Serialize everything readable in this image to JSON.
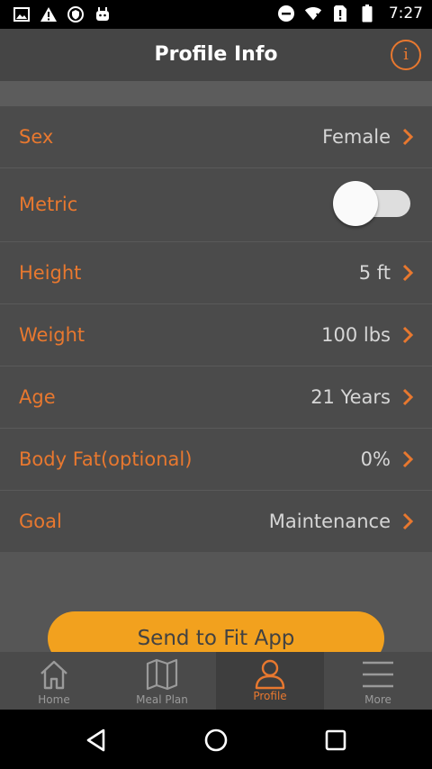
{
  "status_bar": {
    "time": "7:27",
    "icons_left": [
      "image-icon",
      "warning-icon",
      "shield-icon",
      "android-icon"
    ],
    "icons_right": [
      "minus-circle-icon",
      "wifi-icon",
      "no-sim-icon",
      "battery-icon"
    ]
  },
  "header": {
    "title": "Profile Info",
    "info_label": "i"
  },
  "rows": [
    {
      "label": "Sex",
      "value": "Female"
    },
    {
      "label": "Metric",
      "toggle_on": false
    },
    {
      "label": "Height",
      "value": "5 ft"
    },
    {
      "label": "Weight",
      "value": "100 lbs"
    },
    {
      "label": "Age",
      "value": "21 Years"
    },
    {
      "label": "Body Fat(optional)",
      "value": "0%"
    },
    {
      "label": "Goal",
      "value": "Maintenance"
    }
  ],
  "send_button": {
    "label": "Send to Fit App"
  },
  "nav": {
    "items": [
      {
        "label": "Home",
        "icon": "home-icon"
      },
      {
        "label": "Meal Plan",
        "icon": "map-icon"
      },
      {
        "label": "Profile",
        "icon": "person-icon",
        "active": true
      },
      {
        "label": "More",
        "icon": "menu-icon"
      }
    ]
  },
  "colors": {
    "accent": "#e8782f",
    "button": "#f2a11e",
    "row_bg": "#4b4b4b",
    "page_bg": "#565656",
    "header_bg": "#454545"
  }
}
